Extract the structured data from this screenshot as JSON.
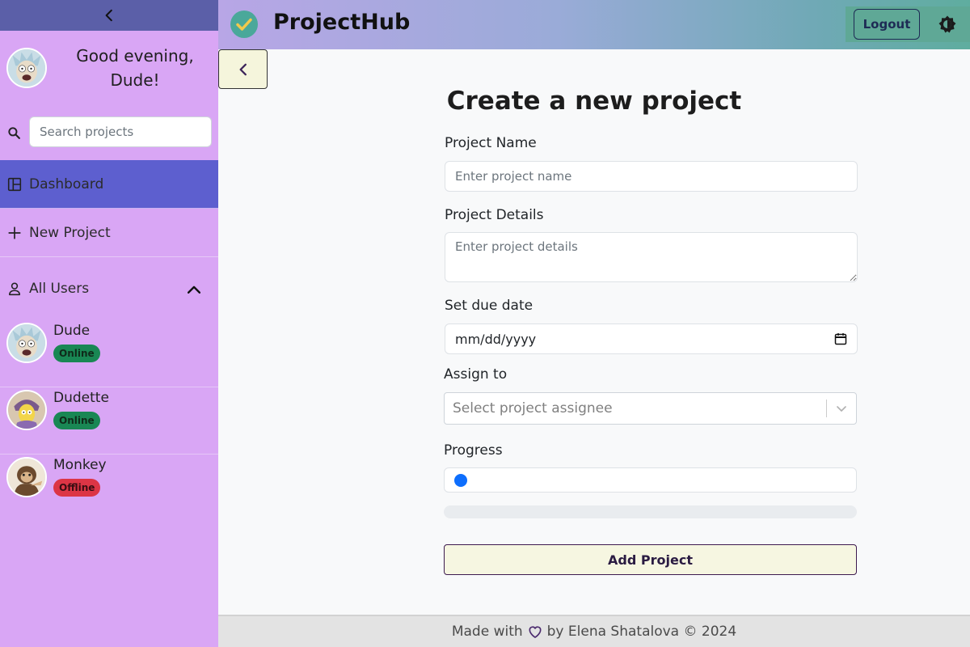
{
  "sidebar": {
    "greeting": "Good evening, Dude!",
    "search_placeholder": "Search projects",
    "nav": [
      {
        "label": "Dashboard",
        "icon": "dashboard-icon",
        "active": true
      },
      {
        "label": "New Project",
        "icon": "plus-icon",
        "active": false
      }
    ],
    "all_users_label": "All Users",
    "users": [
      {
        "name": "Dude",
        "status": "Online"
      },
      {
        "name": "Dudette",
        "status": "Online"
      },
      {
        "name": "Monkey",
        "status": "Offline"
      }
    ]
  },
  "header": {
    "brand": "ProjectHub",
    "logout_label": "Logout"
  },
  "form": {
    "title": "Create a new project",
    "project_name_label": "Project Name",
    "project_name_placeholder": "Enter project name",
    "project_details_label": "Project Details",
    "project_details_placeholder": "Enter project details",
    "due_date_label": "Set due date",
    "due_date_placeholder": "mm/dd/yyyy",
    "assign_label": "Assign to",
    "assign_placeholder": "Select project assignee",
    "progress_label": "Progress",
    "progress_value": 0,
    "submit_label": "Add Project"
  },
  "footer": {
    "made_with": "Made with",
    "by_text": "by Elena Shatalova © 2024"
  },
  "colors": {
    "sidebar_bg": "#d9a6f5",
    "active_nav": "#5d5fcf",
    "online": "#198754",
    "offline": "#dc3545",
    "accent_blue": "#0d6efd"
  }
}
